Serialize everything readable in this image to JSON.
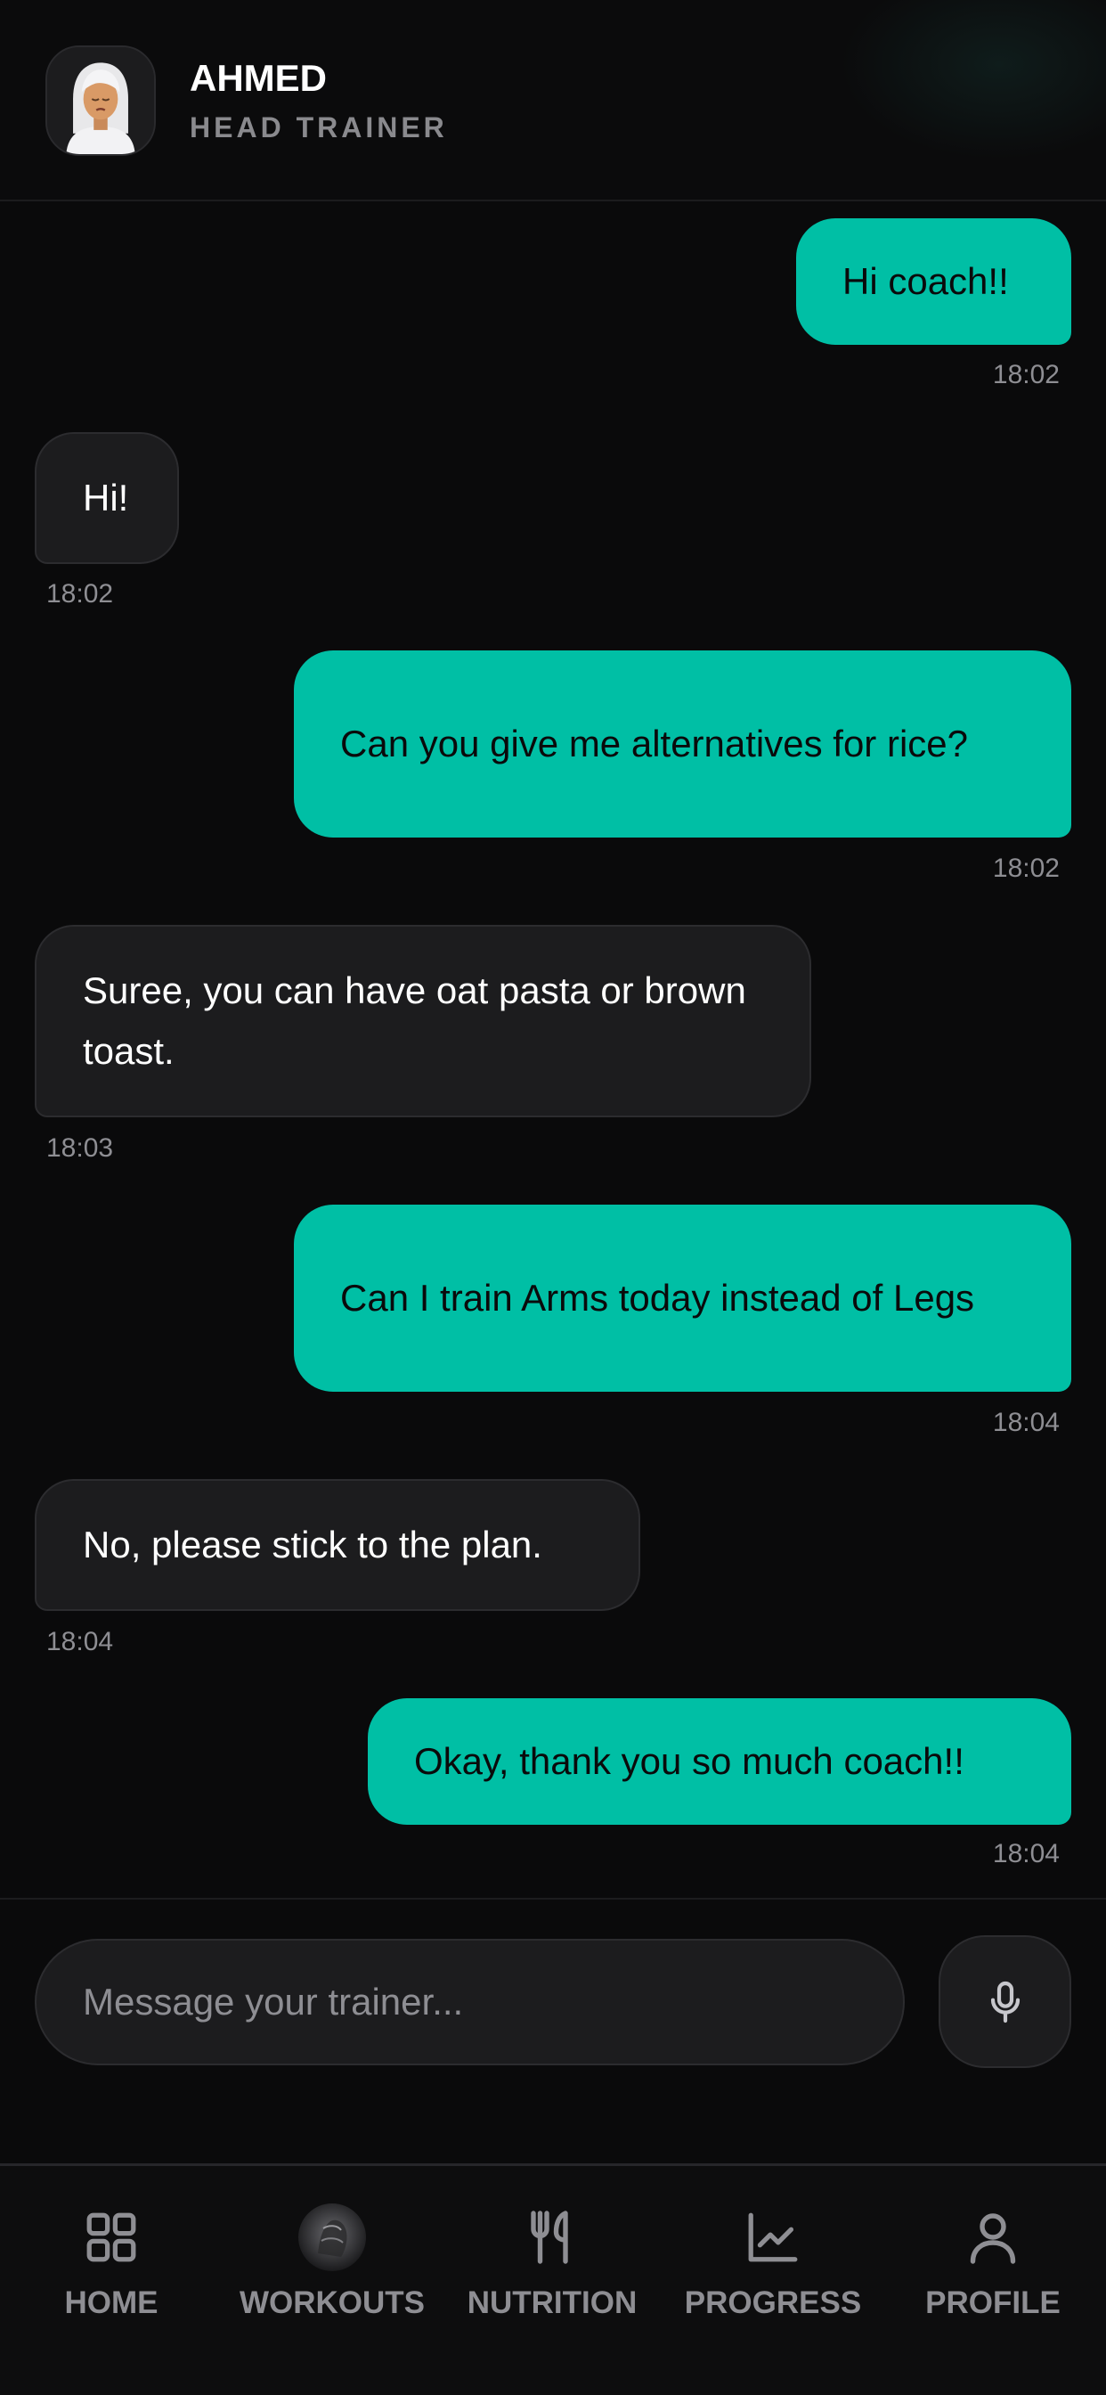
{
  "header": {
    "name": "AHMED",
    "role": "HEAD TRAINER",
    "avatar_icon": "trainer-avatar"
  },
  "messages": [
    {
      "sender": "me",
      "text": "Hi coach!!",
      "time": "18:02"
    },
    {
      "sender": "coach",
      "text": "Hi!",
      "time": "18:02"
    },
    {
      "sender": "me",
      "text": "Can you give me alternatives for rice?",
      "time": "18:02"
    },
    {
      "sender": "coach",
      "text": "Suree, you can have oat pasta or brown toast.",
      "time": "18:03"
    },
    {
      "sender": "me",
      "text": "Can I train Arms today instead of Legs",
      "time": "18:04"
    },
    {
      "sender": "coach",
      "text": "No, please stick to the plan.",
      "time": "18:04"
    },
    {
      "sender": "me",
      "text": "Okay, thank you so much coach!!",
      "time": "18:04"
    }
  ],
  "composer": {
    "placeholder": "Message your trainer...",
    "value": "",
    "mic_icon": "microphone-icon"
  },
  "tabbar": {
    "items": [
      {
        "label": "HOME",
        "icon": "grid-icon"
      },
      {
        "label": "WORKOUTS",
        "icon": "workout-thumbnail"
      },
      {
        "label": "NUTRITION",
        "icon": "fork-knife-icon"
      },
      {
        "label": "PROGRESS",
        "icon": "chart-line-icon"
      },
      {
        "label": "PROFILE",
        "icon": "person-icon"
      }
    ]
  },
  "colors": {
    "background": "#0a0a0b",
    "accent": "#00bfa5",
    "bubble_dark": "#1c1c1e",
    "muted_text": "#8e8e93"
  }
}
